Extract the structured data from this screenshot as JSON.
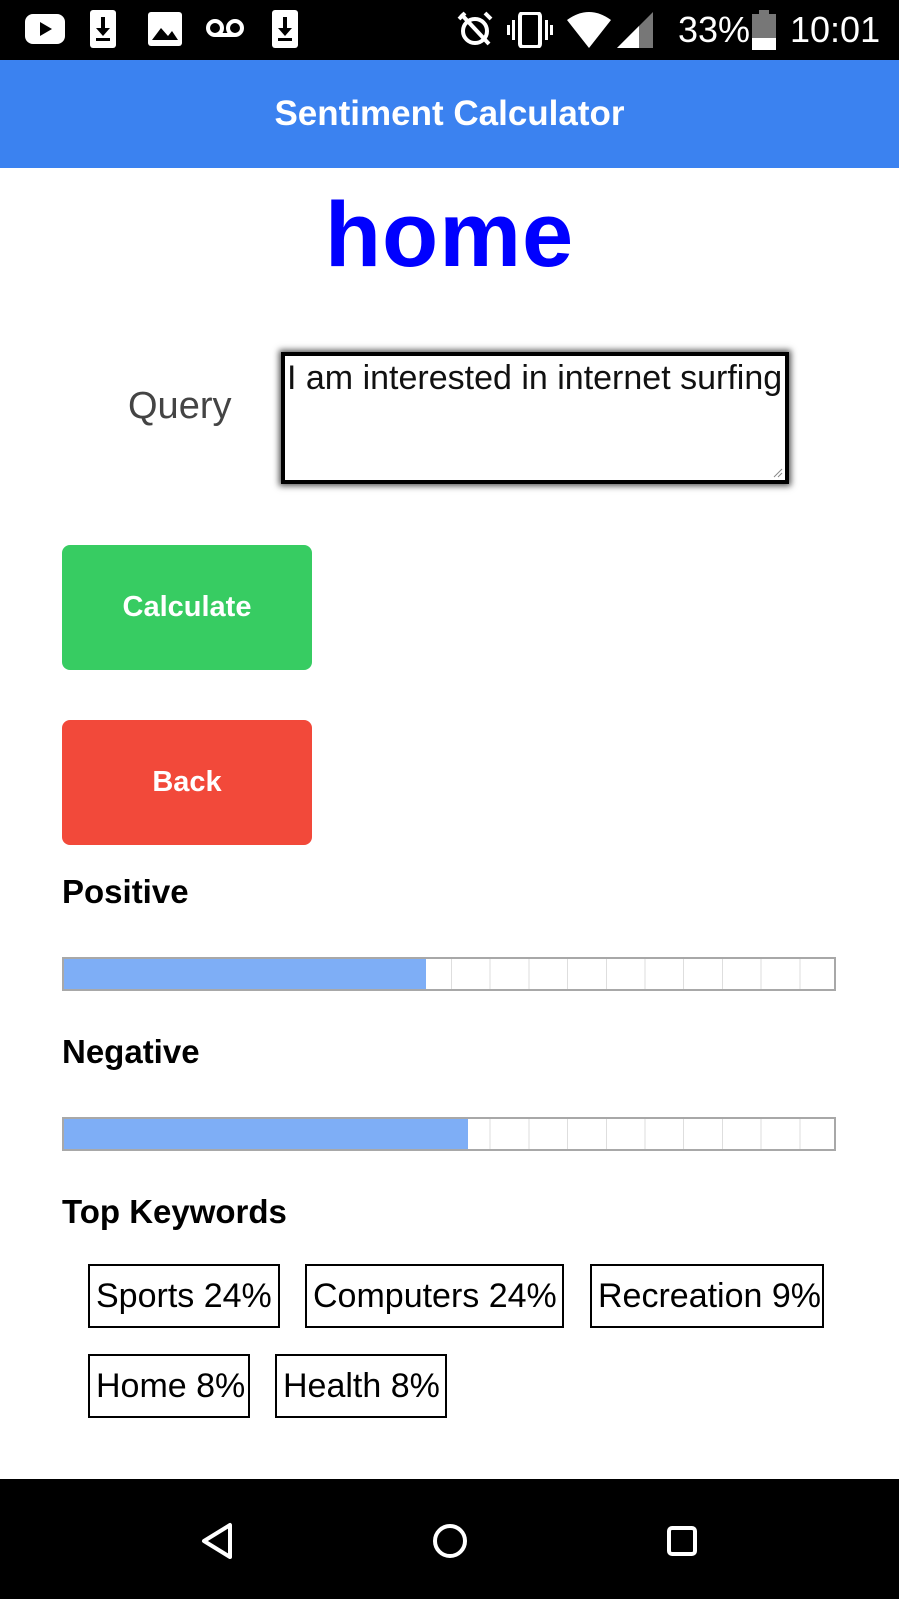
{
  "status_bar": {
    "battery": "33%",
    "time": "10:01",
    "icons": [
      "youtube-icon",
      "download-icon",
      "image-icon",
      "voicemail-icon",
      "download-icon",
      "alarm-off-icon",
      "vibrate-icon",
      "wifi-icon",
      "signal-icon",
      "battery-icon"
    ]
  },
  "app_bar": {
    "title": "Sentiment Calculator",
    "color": "#3b82f0"
  },
  "page": {
    "heading": "home",
    "query_label": "Query",
    "query_value": "I am interested in internet surfing",
    "calculate_label": "Calculate",
    "back_label": "Back",
    "positive_label": "Positive",
    "positive_value": 0.47,
    "negative_label": "Negative",
    "negative_value": 0.525,
    "keywords_label": "Top Keywords",
    "keywords": [
      {
        "text": "Sports 24%"
      },
      {
        "text": "Computers 24%"
      },
      {
        "text": "Recreation 9%"
      },
      {
        "text": "Home 8%"
      },
      {
        "text": "Health 8%"
      }
    ]
  },
  "colors": {
    "calculate": "#37cc62",
    "back": "#f2493a",
    "meter_fill": "#7eaef6",
    "heading": "#0000ff"
  },
  "nav_bar": {
    "icons": [
      "back-triangle-icon",
      "home-circle-icon",
      "recents-square-icon"
    ]
  }
}
